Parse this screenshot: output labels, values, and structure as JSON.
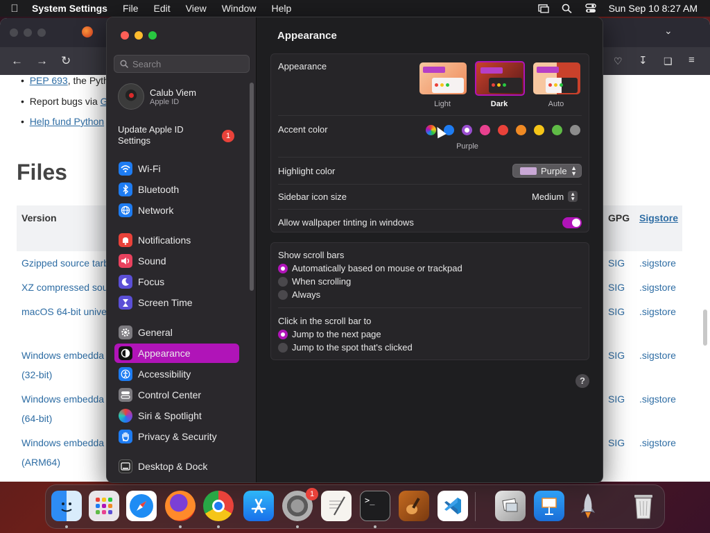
{
  "menubar": {
    "app": "System Settings",
    "menus": [
      "File",
      "Edit",
      "View",
      "Window",
      "Help"
    ],
    "clock": "Sun Sep 10  8:27 AM"
  },
  "browser": {
    "list": {
      "item1_link": "PEP 693",
      "item1_text": ", the Pyth",
      "item2_text": "Report bugs via",
      "item2_link": "G",
      "item3_link": "Help fund Python"
    },
    "files_heading": "Files",
    "table": {
      "col_version": "Version",
      "col_gpg": "GPG",
      "col_sigstore": "Sigstore",
      "rows": [
        {
          "name": "Gzipped source tarb",
          "gpg": "SIG",
          "sig": ".sigstore"
        },
        {
          "name": "XZ compressed sou",
          "gpg": "SIG",
          "sig": ".sigstore"
        },
        {
          "name": "macOS 64-bit unive",
          "gpg": "SIG",
          "sig": ".sigstore"
        },
        {
          "name": "Windows embedda",
          "sub": "(32-bit)",
          "gpg": "SIG",
          "sig": ".sigstore"
        },
        {
          "name": "Windows embedda",
          "sub": "(64-bit)",
          "gpg": "SIG",
          "sig": ".sigstore"
        },
        {
          "name": "Windows embedda",
          "sub": "(ARM64)",
          "gpg": "SIG",
          "sig": ".sigstore"
        }
      ]
    }
  },
  "sidebar": {
    "search_placeholder": "Search",
    "profile_name": "Calub Viem",
    "profile_sub": "Apple ID",
    "update_label": "Update Apple ID Settings",
    "update_badge": "1",
    "items": [
      {
        "label": "Wi-Fi",
        "icon": "wifi-icon",
        "color": "#1e7cf2"
      },
      {
        "label": "Bluetooth",
        "icon": "bluetooth-icon",
        "color": "#1e7cf2"
      },
      {
        "label": "Network",
        "icon": "globe-icon",
        "color": "#1e7cf2"
      },
      {
        "label": "Notifications",
        "icon": "bell-icon",
        "color": "#e9423a"
      },
      {
        "label": "Sound",
        "icon": "speaker-icon",
        "color": "#e9425e"
      },
      {
        "label": "Focus",
        "icon": "moon-icon",
        "color": "#5b4fd6"
      },
      {
        "label": "Screen Time",
        "icon": "hourglass-icon",
        "color": "#5b4fd6"
      },
      {
        "label": "General",
        "icon": "gear-icon",
        "color": "#7d7b80"
      },
      {
        "label": "Appearance",
        "icon": "appearance-icon",
        "color": "#111111"
      },
      {
        "label": "Accessibility",
        "icon": "accessibility-icon",
        "color": "#1e7cf2"
      },
      {
        "label": "Control Center",
        "icon": "control-center-icon",
        "color": "#7d7b80"
      },
      {
        "label": "Siri & Spotlight",
        "icon": "siri-icon",
        "color": "#8a3fd1"
      },
      {
        "label": "Privacy & Security",
        "icon": "hand-icon",
        "color": "#1e7cf2"
      },
      {
        "label": "Desktop & Dock",
        "icon": "dock-icon",
        "color": "#2a2a2a"
      }
    ]
  },
  "content": {
    "title": "Appearance",
    "appearance_label": "Appearance",
    "modes": [
      "Light",
      "Dark",
      "Auto"
    ],
    "accent_label": "Accent color",
    "accent_selected": "Purple",
    "accent_colors": [
      "#8a8a8a",
      "#1e7cf2",
      "#9a4fd0",
      "#e8418f",
      "#e9423a",
      "#f08a24",
      "#f5c518",
      "#5fbb46",
      "#8c8c8c"
    ],
    "highlight_label": "Highlight color",
    "highlight_value": "Purple",
    "icon_size_label": "Sidebar icon size",
    "icon_size_value": "Medium",
    "tinting_label": "Allow wallpaper tinting in windows",
    "scroll_label": "Show scroll bars",
    "scroll_options": [
      "Automatically based on mouse or trackpad",
      "When scrolling",
      "Always"
    ],
    "click_label": "Click in the scroll bar to",
    "click_options": [
      "Jump to the next page",
      "Jump to the spot that's clicked"
    ],
    "help": "?"
  },
  "dock": {
    "badge": "1",
    "apps": [
      "finder-icon",
      "launchpad-icon",
      "safari-icon",
      "firefox-icon",
      "chrome-icon",
      "app-store-icon",
      "system-settings-icon",
      "textedit-icon",
      "terminal-icon",
      "garageband-icon",
      "vscode-icon",
      "preview-icon",
      "keynote-icon",
      "rocket-icon",
      "trash-icon"
    ]
  },
  "colors": {
    "accent": "#b014b8",
    "window_bg": "#1e1e20",
    "sidebar_bg": "#2a282c"
  }
}
